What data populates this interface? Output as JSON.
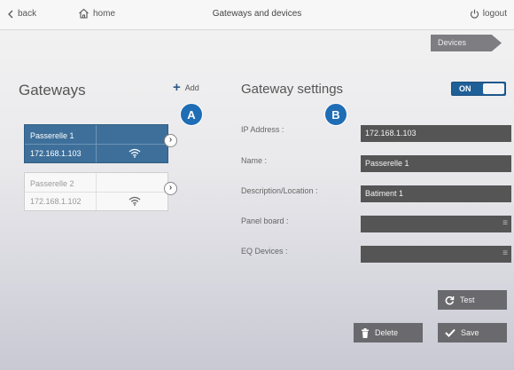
{
  "topbar": {
    "back_label": "back",
    "home_label": "home",
    "title": "Gateways and devices",
    "logout_label": "logout"
  },
  "devices_tab": "Devices",
  "gateways_panel": {
    "title": "Gateways",
    "add_label": "Add",
    "marker": "A",
    "items": [
      {
        "name": "Passerelle 1",
        "ip": "172.168.1.103",
        "selected": true
      },
      {
        "name": "Passerelle 2",
        "ip": "172.168.1.102",
        "selected": false
      }
    ]
  },
  "settings_panel": {
    "title": "Gateway settings",
    "toggle_label": "ON",
    "toggle_on": true,
    "marker": "B",
    "fields": [
      {
        "label": "IP Address :",
        "value": "172.168.1.103"
      },
      {
        "label": "Name :",
        "value": "Passerelle 1"
      },
      {
        "label": "Description/Location :",
        "value": "Batiment 1"
      },
      {
        "label": "Panel board :",
        "value": ""
      },
      {
        "label": "EQ Devices :",
        "value": ""
      }
    ]
  },
  "buttons": {
    "test": "Test",
    "delete": "Delete",
    "save": "Save"
  },
  "colors": {
    "accent": "#1f6db5",
    "selected_card": "#3d6f9a",
    "field_bg": "#555555",
    "button_bg": "#6a6a6e"
  }
}
